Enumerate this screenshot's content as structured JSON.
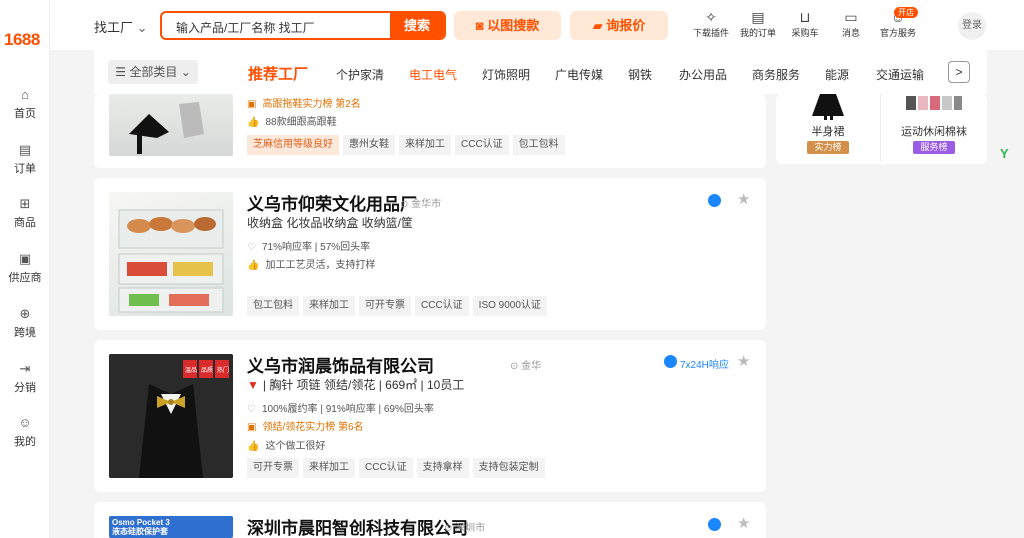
{
  "brand": {
    "logo": "1688"
  },
  "sidebar": {
    "items": [
      {
        "label": "首页",
        "icon": "home-icon"
      },
      {
        "label": "订单",
        "icon": "order-icon"
      },
      {
        "label": "商品",
        "icon": "grid-icon"
      },
      {
        "label": "供应商",
        "icon": "supplier-icon"
      },
      {
        "label": "跨境",
        "icon": "globe-icon"
      },
      {
        "label": "分销",
        "icon": "share-icon"
      },
      {
        "label": "我的",
        "icon": "user-icon"
      }
    ]
  },
  "header": {
    "find_factory": "找工厂",
    "search_placeholder": "输入产品/工厂名称 找工厂",
    "search_button": "搜索",
    "image_search": "以图搜款",
    "inquiry": "询报价",
    "icons": [
      {
        "label": "下载插件",
        "icon": "puzzle-icon"
      },
      {
        "label": "我的订单",
        "icon": "clipboard-icon"
      },
      {
        "label": "采购车",
        "icon": "cart-icon"
      },
      {
        "label": "消息",
        "icon": "message-icon"
      },
      {
        "label": "官方服务",
        "icon": "service-icon"
      }
    ],
    "open_store_badge": "开店",
    "login": "登录"
  },
  "categories": {
    "all": "全部类目",
    "items": [
      "推荐工厂",
      "个护家清",
      "电工电气",
      "灯饰照明",
      "广电传媒",
      "钢铁",
      "办公用品",
      "商务服务",
      "能源",
      "交通运输"
    ],
    "active": "推荐工厂",
    "highlight": "电工电气"
  },
  "cards": [
    {
      "rank": "高跟拖鞋实力榜",
      "rank_no": "第2名",
      "detail": "88款细跟高跟鞋",
      "tags": [
        "芝麻信用等级良好",
        "惠州女鞋",
        "来样加工",
        "CCC认证",
        "包工包料"
      ]
    },
    {
      "name": "义乌市仰荣文化用品厂",
      "location": "金华市",
      "products": "收纳盒 化妆品收纳盒 收纳篮/筐",
      "stats": "71%响应率 | 57%回头率",
      "detail": "加工工艺灵活，支持打样",
      "tags": [
        "包工包料",
        "来样加工",
        "可开专票",
        "CCC认证",
        "ISO 9000认证"
      ]
    },
    {
      "name": "义乌市润晨饰品有限公司",
      "location": "金华",
      "response": "7x24H响应",
      "products": "胸针 项链 领结/领花",
      "area": "669㎡",
      "staff": "10员工",
      "stats": "100%履约率 | 91%响应率 | 69%回头率",
      "rank": "领结/领花实力榜",
      "rank_no": "第6名",
      "detail": "这个做工很好",
      "tags": [
        "可开专票",
        "来样加工",
        "CCC认证",
        "支持拿样",
        "支持包装定制"
      ],
      "thumb_labels": [
        "温品",
        "品质",
        "热门"
      ]
    },
    {
      "name": "深圳市晨阳智创科技有限公司",
      "location": "深圳市",
      "thumb_text1": "Osmo Pocket 3",
      "thumb_text2": "液态硅胶保护套"
    }
  ],
  "right_panel": {
    "items": [
      {
        "label": "半身裙",
        "badge": "实力榜",
        "color": "#d4904a"
      },
      {
        "label": "运动休闲棉袜",
        "badge": "服务榜",
        "color": "#9b5de5"
      }
    ]
  },
  "colors": {
    "brand": "#ff5000",
    "response_blue": "#1a86ff"
  }
}
